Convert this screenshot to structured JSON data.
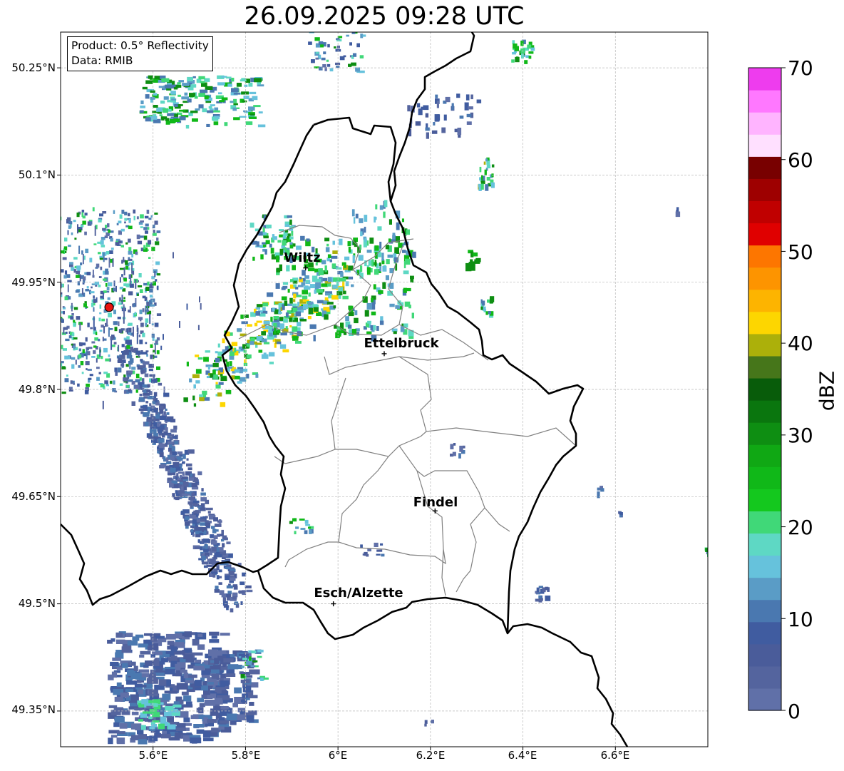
{
  "title": "26.09.2025 09:28 UTC",
  "info": {
    "product": "Product: 0.5° Reflectivity",
    "data_source": "Data: RMIB"
  },
  "lat_labels": [
    "50.25°N",
    "50.1°N",
    "49.95°N",
    "49.8°N",
    "49.65°N",
    "49.5°N",
    "49.35°N"
  ],
  "lon_labels": [
    "5.6°E",
    "5.8°E",
    "6°E",
    "6.2°E",
    "6.4°E",
    "6.6°E"
  ],
  "cities": [
    {
      "name": "Wiltz",
      "lon": 5.93,
      "lat": 49.97
    },
    {
      "name": "Ettelbruck",
      "lon": 6.1,
      "lat": 49.85
    },
    {
      "name": "Findel",
      "lon": 6.21,
      "lat": 49.63
    },
    {
      "name": "Esch/Alzette",
      "lon": 5.99,
      "lat": 49.5
    }
  ],
  "radar_site": {
    "lon": 5.505,
    "lat": 49.915,
    "color": "#e8130f"
  },
  "colorbar": {
    "label": "dBZ",
    "min": 0,
    "max": 70,
    "ticks": [
      "0",
      "10",
      "20",
      "30",
      "40",
      "50",
      "60",
      "70"
    ],
    "colors": [
      "#6070a8",
      "#54649e",
      "#4a5c9a",
      "#405ca0",
      "#4a78b0",
      "#5a9cc6",
      "#66c2dc",
      "#5ed8c4",
      "#40d878",
      "#14c81e",
      "#10b818",
      "#10a814",
      "#0e8e12",
      "#0a760e",
      "#085c0a",
      "#46761a",
      "#acb00a",
      "#fdd600",
      "#fdb400",
      "#fd9400",
      "#fd7600",
      "#e00000",
      "#c00000",
      "#9e0000",
      "#780000",
      "#ffe0ff",
      "#ffb4ff",
      "#ff78ff",
      "#ee3cee"
    ]
  },
  "map_extent": {
    "lon_min": 5.4,
    "lon_max": 6.8,
    "lat_min": 49.3,
    "lat_max": 50.3
  }
}
